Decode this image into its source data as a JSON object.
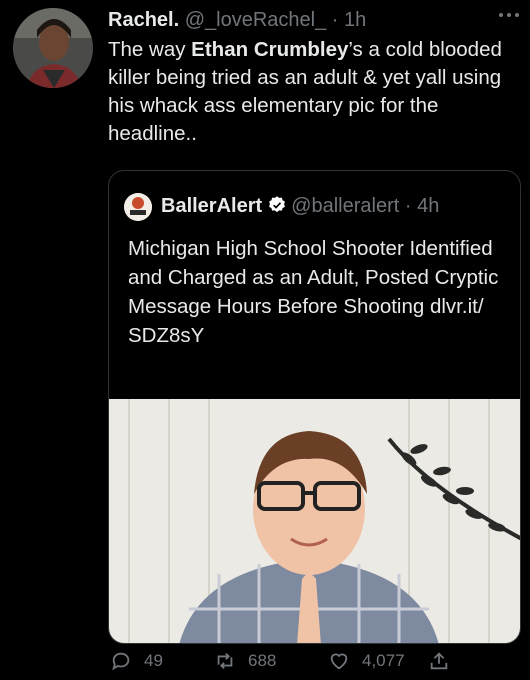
{
  "tweet": {
    "author_name": "Rachel.",
    "handle": "@_loveRachel_",
    "separator": "·",
    "time": "1h",
    "text_prefix": "The way ",
    "text_bold": "Ethan Crumbley",
    "text_suffix": "’s a cold blooded killer being tried as an adult & yet yall using his whack ass elementary pic for the headline.."
  },
  "quoted": {
    "author_name": "BallerAlert",
    "handle": "@balleralert",
    "separator": "·",
    "time": "4h",
    "text": "Michigan High School Shooter Identified and Charged as an Adult, Posted Cryptic Message Hours Before Shooting dlvr.it/ SDZ8sY"
  },
  "actions": {
    "replies": "49",
    "retweets": "688",
    "likes": "4,077"
  },
  "colors": {
    "background": "#000000",
    "text": "#e7e9ea",
    "muted": "#71767b",
    "verified": "#ffffff",
    "border": "#2f3336"
  },
  "icons": [
    "more-icon",
    "verified-icon",
    "reply-icon",
    "retweet-icon",
    "like-icon",
    "share-icon"
  ]
}
